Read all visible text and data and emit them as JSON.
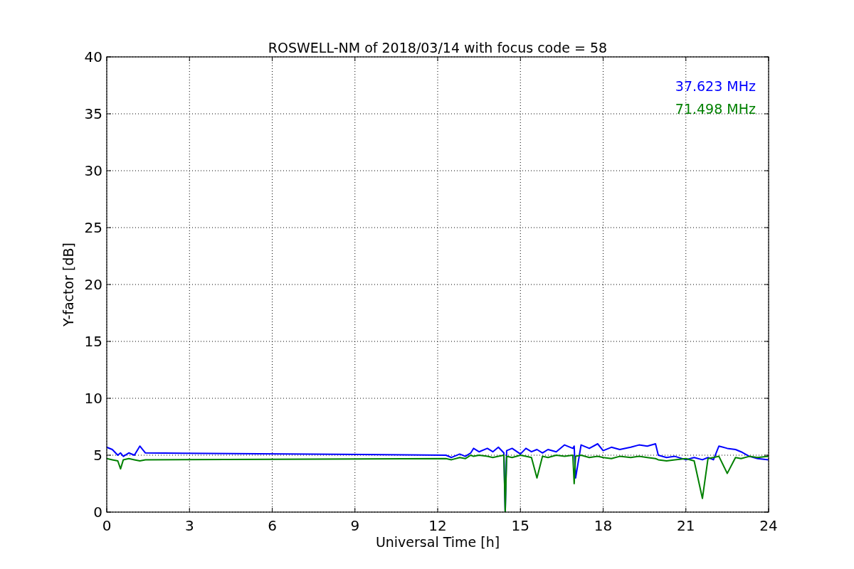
{
  "figure": {
    "chart_data": {
      "type": "line",
      "title": "ROSWELL-NM of 2018/03/14 with focus code = 58",
      "xlabel": "Universal Time [h]",
      "ylabel": "Y-factor [dB]",
      "x": [
        0,
        0.2,
        0.4,
        0.5,
        0.6,
        0.8,
        1.0,
        1.2,
        1.4,
        12.3,
        12.5,
        12.8,
        13.0,
        13.2,
        13.3,
        13.5,
        13.8,
        14.0,
        14.2,
        14.4,
        14.45,
        14.5,
        14.7,
        15.0,
        15.2,
        15.4,
        15.6,
        15.8,
        16.0,
        16.3,
        16.6,
        16.9,
        16.95,
        17.0,
        17.2,
        17.5,
        17.8,
        18.0,
        18.3,
        18.6,
        19.0,
        19.3,
        19.6,
        19.9,
        20.0,
        20.3,
        20.6,
        21.0,
        21.3,
        21.6,
        21.8,
        22.0,
        22.2,
        22.5,
        22.8,
        23.0,
        23.3,
        23.6,
        24.0
      ],
      "series": [
        {
          "name": "37.623 MHz",
          "color": "#0000ff",
          "values": [
            5.7,
            5.5,
            5.0,
            5.2,
            4.9,
            5.2,
            5.0,
            5.8,
            5.2,
            5.0,
            4.8,
            5.1,
            4.9,
            5.2,
            5.6,
            5.3,
            5.6,
            5.3,
            5.7,
            5.2,
            0,
            5.4,
            5.6,
            5.1,
            5.6,
            5.3,
            5.5,
            5.2,
            5.5,
            5.3,
            5.9,
            5.6,
            5.8,
            3.0,
            5.9,
            5.6,
            6.0,
            5.4,
            5.7,
            5.5,
            5.7,
            5.9,
            5.8,
            6.0,
            5.0,
            4.8,
            4.9,
            4.6,
            4.8,
            4.6,
            4.8,
            4.6,
            5.8,
            5.6,
            5.5,
            5.3,
            4.9,
            4.7,
            4.6
          ]
        },
        {
          "name": "71.498 MHz",
          "color": "#008000",
          "values": [
            4.7,
            4.6,
            4.5,
            3.8,
            4.6,
            4.7,
            4.6,
            4.5,
            4.6,
            4.7,
            4.6,
            4.8,
            4.7,
            5.0,
            4.9,
            5.0,
            4.9,
            4.8,
            4.9,
            5.0,
            0,
            4.9,
            4.8,
            5.0,
            4.9,
            4.8,
            3.0,
            4.9,
            4.8,
            5.0,
            4.9,
            5.0,
            2.5,
            4.9,
            5.0,
            4.8,
            4.9,
            4.8,
            4.7,
            4.9,
            4.8,
            4.9,
            4.8,
            4.7,
            4.6,
            4.5,
            4.6,
            4.7,
            4.5,
            1.2,
            4.7,
            4.8,
            4.9,
            3.4,
            4.8,
            4.7,
            4.9,
            4.8,
            4.9
          ]
        }
      ],
      "xlim": [
        0,
        24
      ],
      "ylim": [
        0,
        40
      ],
      "xticks": [
        0,
        3,
        6,
        9,
        12,
        15,
        18,
        21,
        24
      ],
      "yticks": [
        0,
        5,
        10,
        15,
        20,
        25,
        30,
        35,
        40
      ],
      "grid": true
    }
  }
}
